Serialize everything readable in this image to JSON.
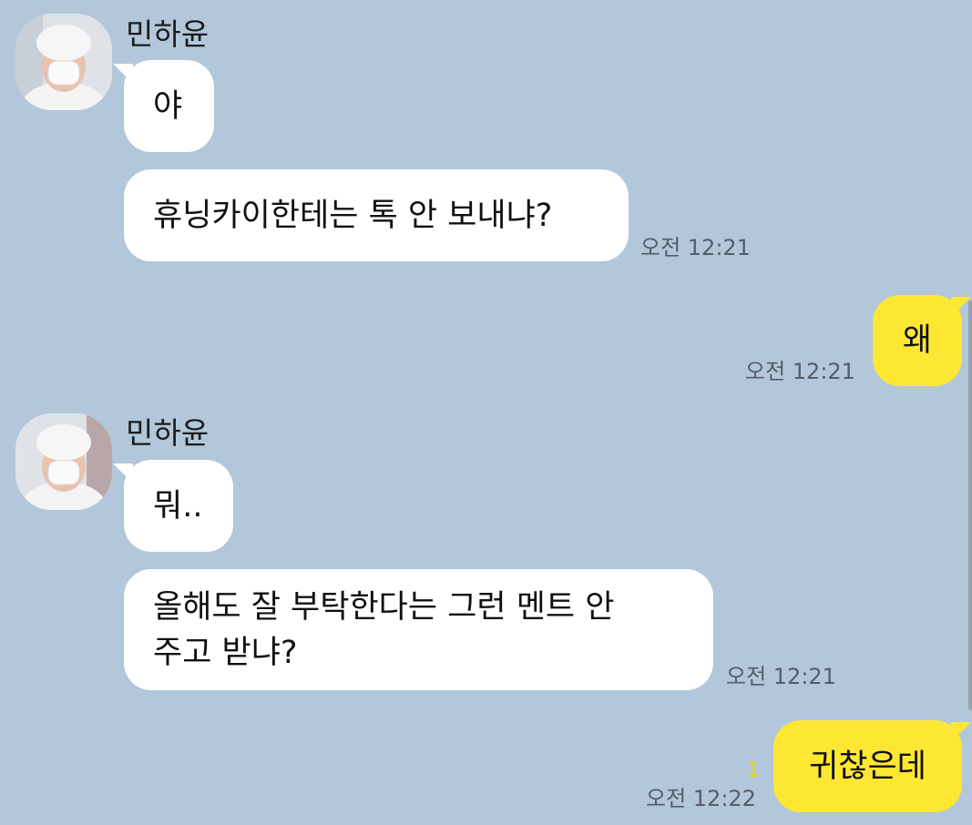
{
  "messages": [
    {
      "sender": "민하윤",
      "bubbles": [
        "야",
        "휴닝카이한테는 톡 안 보내냐?"
      ],
      "time": "오전 12:21"
    },
    {
      "sender": "me",
      "bubbles": [
        "왜"
      ],
      "time": "오전 12:21"
    },
    {
      "sender": "민하윤",
      "bubbles": [
        "뭐..",
        "올해도 잘 부탁한다는 그런 멘트 안\n주고 받냐?"
      ],
      "time": "오전 12:21"
    },
    {
      "sender": "me",
      "bubbles": [
        "귀찮은데"
      ],
      "time": "오전 12:22",
      "unread_count": "1"
    }
  ],
  "colors": {
    "background": "#b2c7da",
    "incoming_bubble": "#ffffff",
    "outgoing_bubble": "#fee733",
    "unread": "#f0d000"
  }
}
